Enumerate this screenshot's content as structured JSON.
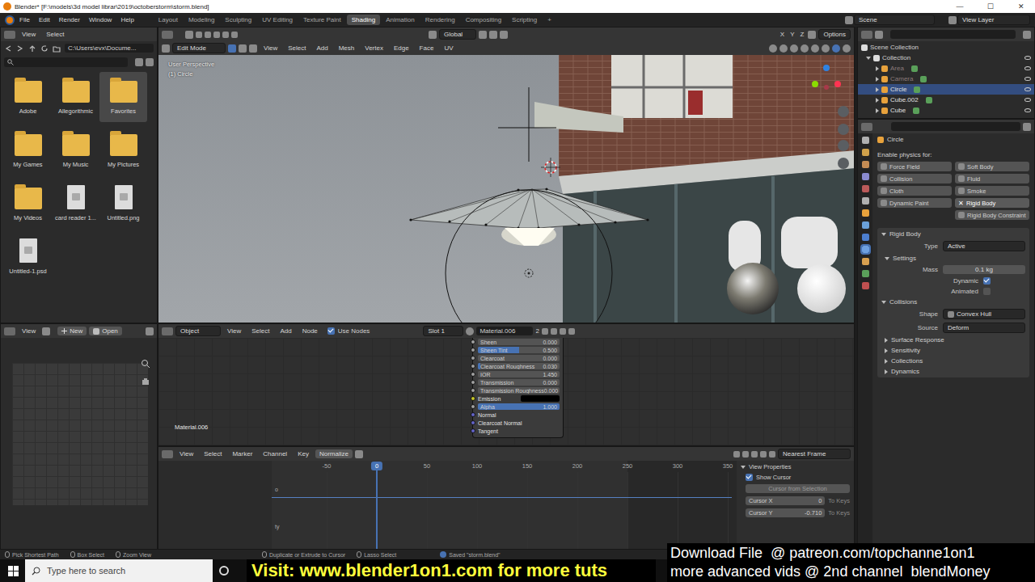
{
  "window": {
    "title": "Blender* [F:\\models\\3d model librar\\2019\\octoberstorm\\storm.blend]",
    "controls": [
      "—",
      "☐",
      "✕"
    ]
  },
  "topbar": {
    "menus": [
      "File",
      "Edit",
      "Render",
      "Window",
      "Help"
    ],
    "workspaces": [
      {
        "label": "Layout",
        "selected": false
      },
      {
        "label": "Modeling",
        "selected": false
      },
      {
        "label": "Sculpting",
        "selected": false
      },
      {
        "label": "UV Editing",
        "selected": false
      },
      {
        "label": "Texture Paint",
        "selected": false
      },
      {
        "label": "Shading",
        "selected": true
      },
      {
        "label": "Animation",
        "selected": false
      },
      {
        "label": "Rendering",
        "selected": false
      },
      {
        "label": "Compositing",
        "selected": false
      },
      {
        "label": "Scripting",
        "selected": false
      },
      {
        "label": "+",
        "selected": false
      }
    ],
    "scene": "Scene",
    "view_layer": "View Layer"
  },
  "file_browser": {
    "menus": [
      "View",
      "Select"
    ],
    "path": "C:\\Users\\evx\\Docume...",
    "items": [
      {
        "label": "Adobe",
        "kind": "folder",
        "selected": false
      },
      {
        "label": "Allegorithmic",
        "kind": "folder",
        "selected": false
      },
      {
        "label": "Favorites",
        "kind": "folder",
        "selected": true
      },
      {
        "label": "My Games",
        "kind": "folder",
        "selected": false
      },
      {
        "label": "My Music",
        "kind": "folder",
        "selected": false
      },
      {
        "label": "My Pictures",
        "kind": "folder",
        "selected": false
      },
      {
        "label": "My Videos",
        "kind": "folder",
        "selected": false
      },
      {
        "label": "card reader 1...",
        "kind": "file",
        "selected": false
      },
      {
        "label": "Untitled.png",
        "kind": "file",
        "selected": false
      },
      {
        "label": "Untitled-1.psd",
        "kind": "file",
        "selected": false
      }
    ]
  },
  "image_editor": {
    "menus": [
      "View"
    ],
    "new": "New",
    "open": "Open"
  },
  "viewport": {
    "mode": "Edit Mode",
    "menus": [
      "View",
      "Select",
      "Add",
      "Mesh",
      "Vertex",
      "Edge",
      "Face",
      "UV"
    ],
    "orientation": "Global",
    "axes": [
      "X",
      "Y",
      "Z"
    ],
    "options": "Options",
    "overlay": [
      "User Perspective",
      "(1) Circle"
    ]
  },
  "node_editor": {
    "type": "Object",
    "menus": [
      "View",
      "Select",
      "Add",
      "Node"
    ],
    "use_nodes": {
      "label": "Use Nodes",
      "checked": true
    },
    "slot": "Slot 1",
    "material": "Material.006",
    "user_count": "2",
    "label": "Material.006",
    "node_rows": [
      {
        "label": "Sheen",
        "value": "0.000",
        "kind": "slider",
        "level": 0,
        "color": "#a1a1a1"
      },
      {
        "label": "Sheen Tint",
        "value": "0.500",
        "kind": "slider",
        "level": 0.5,
        "color": "#a1a1a1"
      },
      {
        "label": "Clearcoat",
        "value": "0.000",
        "kind": "slider",
        "level": 0,
        "color": "#a1a1a1"
      },
      {
        "label": "Clearcoat Roughness",
        "value": "0.030",
        "kind": "slider",
        "level": 0.03,
        "color": "#a1a1a1"
      },
      {
        "label": "IOR",
        "value": "1.450",
        "kind": "number",
        "color": "#a1a1a1"
      },
      {
        "label": "Transmission",
        "value": "0.000",
        "kind": "slider",
        "level": 0,
        "color": "#a1a1a1"
      },
      {
        "label": "Transmission Roughness",
        "value": "0.000",
        "kind": "slider",
        "level": 0,
        "color": "#a1a1a1"
      },
      {
        "label": "Emission",
        "kind": "color",
        "color": "#c7c729",
        "swatch": "#000000"
      },
      {
        "label": "Alpha",
        "value": "1.000",
        "kind": "slider",
        "level": 1,
        "color": "#a1a1a1"
      },
      {
        "label": "Normal",
        "kind": "socket",
        "color": "#6363c7"
      },
      {
        "label": "Clearcoat Normal",
        "kind": "socket",
        "color": "#6363c7"
      },
      {
        "label": "Tangent",
        "kind": "socket",
        "color": "#6363c7"
      }
    ]
  },
  "timeline": {
    "menus": [
      "View",
      "Select",
      "Marker",
      "Channel",
      "Key"
    ],
    "normalize": {
      "label": "Normalize",
      "checked": false
    },
    "snap": "Nearest Frame",
    "ticks": [
      "-50",
      "50",
      "100",
      "150",
      "200",
      "250",
      "300",
      "350"
    ],
    "current_frame": "0",
    "channel_labels": [
      "o",
      "ty"
    ],
    "view_properties": {
      "title": "View Properties",
      "show_cursor": {
        "label": "Show Cursor",
        "checked": true
      },
      "cursor_from_selection": "Cursor from Selection",
      "rows": [
        {
          "label": "Cursor X",
          "value": "0",
          "action": "To Keys"
        },
        {
          "label": "Cursor Y",
          "value": "-0.710",
          "action": "To Keys"
        }
      ]
    }
  },
  "outliner": {
    "root": "Scene Collection",
    "collection": "Collection",
    "objects": [
      {
        "label": "Area",
        "selected": false,
        "dimmed": true
      },
      {
        "label": "Camera",
        "selected": false,
        "dimmed": true
      },
      {
        "label": "Circle",
        "selected": true,
        "dimmed": false
      },
      {
        "label": "Cube.002",
        "selected": false,
        "dimmed": false
      },
      {
        "label": "Cube",
        "selected": false,
        "dimmed": false
      }
    ]
  },
  "properties": {
    "object": "Circle",
    "physics_label": "Enable physics for:",
    "remove_glyph": "✕",
    "physics_buttons": [
      {
        "label": "Force Field",
        "active": false
      },
      {
        "label": "Soft Body",
        "active": false
      },
      {
        "label": "Collision",
        "active": false
      },
      {
        "label": "Fluid",
        "active": false
      },
      {
        "label": "Cloth",
        "active": false
      },
      {
        "label": "Smoke",
        "active": false
      },
      {
        "label": "Dynamic Paint",
        "active": false
      },
      {
        "label": "Rigid Body",
        "active": true
      },
      {
        "label": "Rigid Body Constraint",
        "active": false,
        "wide": true
      }
    ],
    "rigid_body": {
      "title": "Rigid Body",
      "type_label": "Type",
      "type_value": "Active",
      "settings": "Settings",
      "mass_label": "Mass",
      "mass_value": "0.1 kg",
      "dynamic": {
        "label": "Dynamic",
        "checked": true
      },
      "animated": {
        "label": "Animated",
        "checked": false
      },
      "collisions": "Collisions",
      "shape_label": "Shape",
      "shape_value": "Convex Hull",
      "source_label": "Source",
      "source_value": "Deform",
      "subpanels": [
        {
          "label": "Surface Response",
          "expanded": false
        },
        {
          "label": "Sensitivity",
          "expanded": false
        },
        {
          "label": "Collections",
          "expanded": false
        },
        {
          "label": "Dynamics",
          "expanded": false
        }
      ]
    }
  },
  "status_bar": {
    "items": [
      "Pick Shortest Path",
      "Box Select",
      "Zoom View",
      "Duplicate or Extrude to Cursor",
      "Lasso Select"
    ],
    "message": "Saved \"storm.blend\""
  },
  "taskbar": {
    "search": "Type here to search"
  },
  "watermarks": {
    "banner": "Visit: www.blender1on1.com for more tuts",
    "right": [
      "Download File  @ patreon.com/topchanne1on1",
      "more advanced vids @ 2nd channel  blendMoney"
    ]
  }
}
